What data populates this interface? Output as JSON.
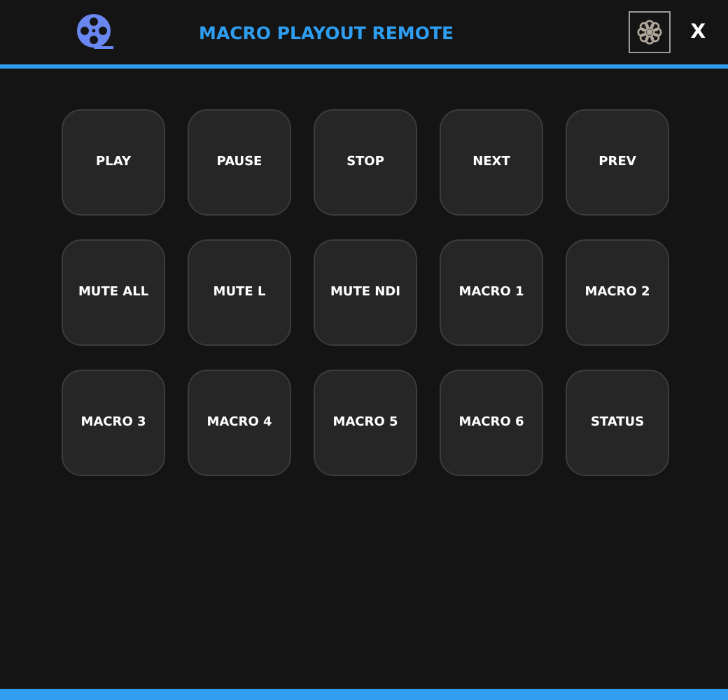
{
  "header": {
    "title": "MACRO PLAYOUT REMOTE",
    "close": "X"
  },
  "buttons": [
    "PLAY",
    "PAUSE",
    "STOP",
    "NEXT",
    "PREV",
    "MUTE ALL",
    "MUTE L",
    "MUTE NDI",
    "MACRO 1",
    "MACRO 2",
    "MACRO 3",
    "MACRO 4",
    "MACRO 5",
    "MACRO 6",
    "STATUS"
  ]
}
